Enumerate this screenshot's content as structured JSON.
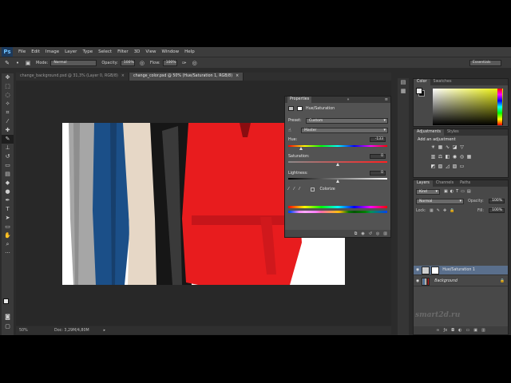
{
  "app": {
    "logo": "Ps",
    "menu": [
      "File",
      "Edit",
      "Image",
      "Layer",
      "Type",
      "Select",
      "Filter",
      "3D",
      "View",
      "Window",
      "Help"
    ]
  },
  "options_bar": {
    "mode_label": "Mode:",
    "mode_value": "Normal",
    "opacity_label": "Opacity:",
    "opacity_value": "100%",
    "flow_label": "Flow:",
    "flow_value": "100%",
    "workspace": "Essentials"
  },
  "tabs": [
    {
      "label": "change_background.psd @ 31,3% (Layer 0, RGB/8)",
      "close": "×"
    },
    {
      "label": "change_color.psd @ 50% (Hue/Saturation 1, RGB/8)",
      "close": "×"
    }
  ],
  "status": {
    "zoom": "50%",
    "doc": "Doc: 3,29M/4,80M"
  },
  "properties": {
    "tab": "Properties",
    "collapse": "»",
    "menu": "≡",
    "title": "Hue/Saturation",
    "preset_label": "Preset:",
    "preset_value": "Custom",
    "channel_value": "Master",
    "hue_label": "Hue:",
    "hue_value": "-133",
    "hue_level": 0.13,
    "saturation_label": "Saturation:",
    "saturation_value": "0",
    "saturation_level": 0.5,
    "lightness_label": "Lightness:",
    "lightness_value": "0",
    "lightness_level": 0.5,
    "colorize_label": "Colorize"
  },
  "color_panel": {
    "tabs": [
      "Color",
      "Swatches"
    ]
  },
  "adjustments_panel": {
    "tabs": [
      "Adjustments",
      "Styles"
    ],
    "heading": "Add an adjustment"
  },
  "layers_panel": {
    "tabs": [
      "Layers",
      "Channels",
      "Paths"
    ],
    "kind_value": "Kind",
    "blend_value": "Normal",
    "opacity_label": "Opacity:",
    "opacity_value": "100%",
    "lock_label": "Lock:",
    "fill_label": "Fill:",
    "fill_value": "100%",
    "layers": [
      {
        "name": "Hue/Saturation 1",
        "selected": true
      },
      {
        "name": "Background",
        "selected": false
      }
    ]
  },
  "watermark": "smart2d.ru",
  "colors": {
    "coat_red": "#e81c1e",
    "coat_blue": "#1b4f88",
    "coat_beige": "#e6d7c6",
    "coat_gray": "#a6a6a6",
    "coat_black": "#161616",
    "selection_blue": "#5a6f8c"
  }
}
